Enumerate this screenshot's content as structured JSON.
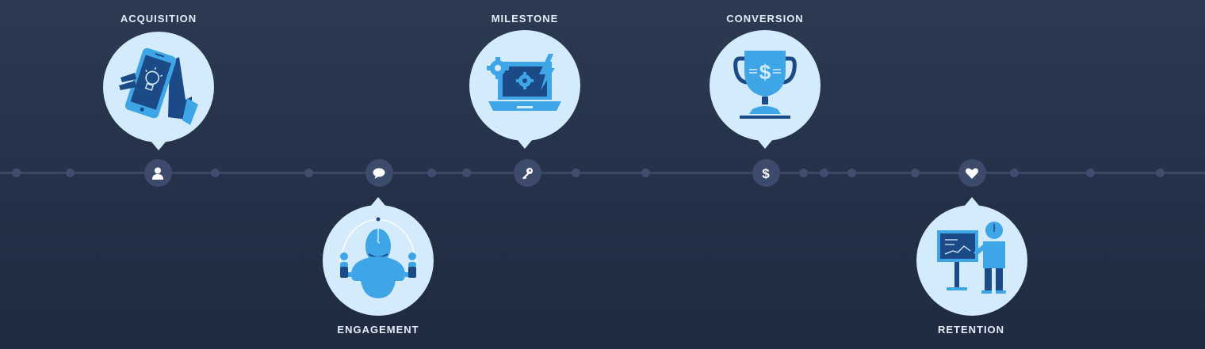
{
  "stages": [
    {
      "label": "ACQUISITION",
      "icon": "phone-hand-lightbulb-icon",
      "marker_icon": "user-icon",
      "position": "above"
    },
    {
      "label": "ENGAGEMENT",
      "icon": "person-juggling-icon",
      "marker_icon": "speech-bubble-icon",
      "position": "below"
    },
    {
      "label": "MILESTONE",
      "icon": "laptop-gears-icon",
      "marker_icon": "key-icon",
      "position": "above"
    },
    {
      "label": "CONVERSION",
      "icon": "trophy-dollar-icon",
      "marker_icon": "dollar-icon",
      "position": "above"
    },
    {
      "label": "RETENTION",
      "icon": "person-presenting-chart-icon",
      "marker_icon": "heart-icon",
      "position": "below"
    }
  ],
  "colors": {
    "background": "#263449",
    "line": "#3a4866",
    "bubble": "#d3ebfa",
    "icon_light": "#3ea6e6",
    "icon_dark": "#1c4a86",
    "label": "#e3eefa"
  }
}
